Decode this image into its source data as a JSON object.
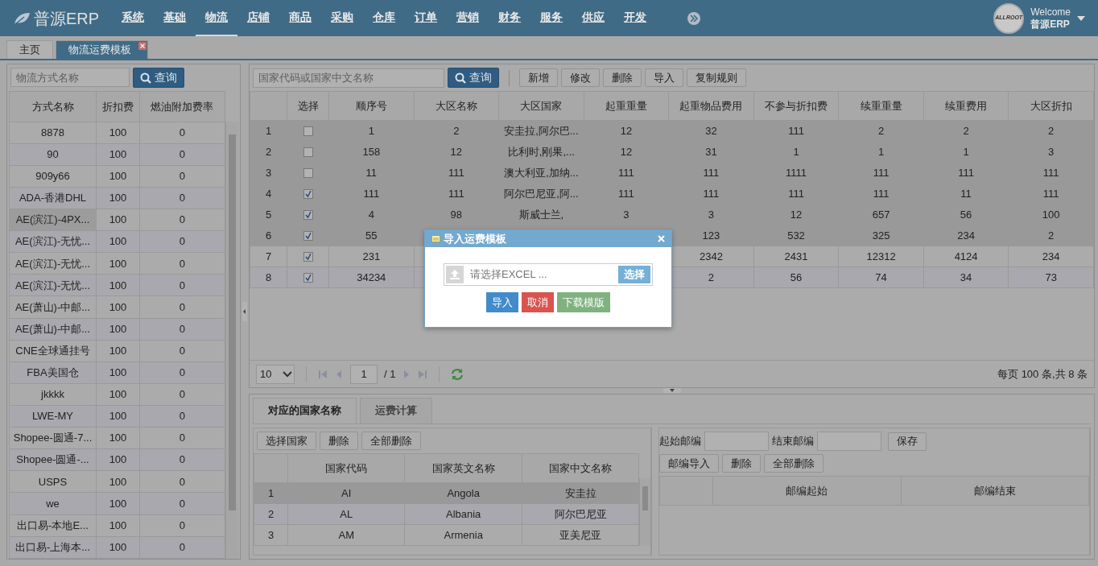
{
  "header": {
    "logo": "普源ERP",
    "nav": [
      {
        "label": "系统",
        "selected": false
      },
      {
        "label": "基础",
        "selected": false
      },
      {
        "label": "物流",
        "selected": true
      },
      {
        "label": "店铺",
        "selected": false
      },
      {
        "label": "商品",
        "selected": false
      },
      {
        "label": "采购",
        "selected": false
      },
      {
        "label": "仓库",
        "selected": false
      },
      {
        "label": "订单",
        "selected": false
      },
      {
        "label": "营销",
        "selected": false
      },
      {
        "label": "财务",
        "selected": false
      },
      {
        "label": "服务",
        "selected": false
      },
      {
        "label": "供应",
        "selected": false
      },
      {
        "label": "开发",
        "selected": false
      }
    ],
    "user": {
      "avatar_text": "ALLROOT",
      "greeting": "Welcome",
      "name": "普源ERP"
    }
  },
  "tabs": [
    {
      "label": "主页",
      "selected": false,
      "closable": false
    },
    {
      "label": "物流运费模板",
      "selected": true,
      "closable": true
    }
  ],
  "left_panel": {
    "search": {
      "placeholder": "物流方式名称"
    },
    "search_button": "查询",
    "columns": [
      "方式名称",
      "折扣费",
      "燃油附加费率"
    ],
    "rows": [
      {
        "cells": [
          "8878",
          "100",
          "0"
        ],
        "selected": false
      },
      {
        "cells": [
          "90",
          "100",
          "0"
        ],
        "selected": false
      },
      {
        "cells": [
          "909y66",
          "100",
          "0"
        ],
        "selected": false
      },
      {
        "cells": [
          "ADA-香港DHL",
          "100",
          "0"
        ],
        "selected": false
      },
      {
        "cells": [
          "AE(滨江)-4PX...",
          "100",
          "0"
        ],
        "selected": true
      },
      {
        "cells": [
          "AE(滨江)-无忧...",
          "100",
          "0"
        ],
        "selected": false
      },
      {
        "cells": [
          "AE(滨江)-无忧...",
          "100",
          "0"
        ],
        "selected": false
      },
      {
        "cells": [
          "AE(滨江)-无忧...",
          "100",
          "0"
        ],
        "selected": false
      },
      {
        "cells": [
          "AE(萧山)-中邮...",
          "100",
          "0"
        ],
        "selected": false
      },
      {
        "cells": [
          "AE(萧山)-中邮...",
          "100",
          "0"
        ],
        "selected": false
      },
      {
        "cells": [
          "CNE全球通挂号",
          "100",
          "0"
        ],
        "selected": false
      },
      {
        "cells": [
          "FBA美国仓",
          "100",
          "0"
        ],
        "selected": false
      },
      {
        "cells": [
          "jkkkk",
          "100",
          "0"
        ],
        "selected": false
      },
      {
        "cells": [
          "LWE-MY",
          "100",
          "0"
        ],
        "selected": false
      },
      {
        "cells": [
          "Shopee-圆通-7...",
          "100",
          "0"
        ],
        "selected": false
      },
      {
        "cells": [
          "Shopee-圆通-...",
          "100",
          "0"
        ],
        "selected": false
      },
      {
        "cells": [
          "USPS",
          "100",
          "0"
        ],
        "selected": false
      },
      {
        "cells": [
          "we",
          "100",
          "0"
        ],
        "selected": false
      },
      {
        "cells": [
          "出口易-本地E...",
          "100",
          "0"
        ],
        "selected": false
      },
      {
        "cells": [
          "出口易-上海本...",
          "100",
          "0"
        ],
        "selected": false
      }
    ]
  },
  "main": {
    "search": {
      "placeholder": "国家代码或国家中文名称"
    },
    "search_button": "查询",
    "toolbar": [
      "新增",
      "修改",
      "删除",
      "导入",
      "复制规则"
    ],
    "select_column": "选择",
    "columns": [
      "顺序号",
      "大区名称",
      "大区国家",
      "起重重量",
      "起重物品费用",
      "不参与折扣费",
      "续重重量",
      "续重费用",
      "大区折扣"
    ],
    "rows": [
      {
        "num": "1",
        "checked": false,
        "selected": true,
        "cells": [
          "1",
          "2",
          "安圭拉,阿尔巴...",
          "12",
          "32",
          "111",
          "2",
          "2",
          "2"
        ]
      },
      {
        "num": "2",
        "checked": false,
        "selected": true,
        "cells": [
          "158",
          "12",
          "比利时,刚果,...",
          "12",
          "31",
          "1",
          "1",
          "1",
          "3"
        ]
      },
      {
        "num": "3",
        "checked": false,
        "selected": true,
        "cells": [
          "11",
          "111",
          "澳大利亚,加纳...",
          "111",
          "111",
          "1111",
          "111",
          "111",
          "111"
        ]
      },
      {
        "num": "4",
        "checked": true,
        "selected": true,
        "cells": [
          "111",
          "111",
          "阿尔巴尼亚,阿...",
          "111",
          "111",
          "111",
          "111",
          "11",
          "111"
        ]
      },
      {
        "num": "5",
        "checked": true,
        "selected": true,
        "cells": [
          "4",
          "98",
          "斯威士兰,",
          "3",
          "3",
          "12",
          "657",
          "56",
          "100"
        ]
      },
      {
        "num": "6",
        "checked": true,
        "selected": true,
        "cells": [
          "55",
          null,
          null,
          null,
          "123",
          "532",
          "325",
          "234",
          "2"
        ]
      },
      {
        "num": "7",
        "checked": true,
        "selected": false,
        "cells": [
          "231",
          null,
          null,
          null,
          "2342",
          "2431",
          "12312",
          "4124",
          "234"
        ]
      },
      {
        "num": "8",
        "checked": true,
        "selected": false,
        "cells": [
          "34234",
          null,
          null,
          null,
          "2",
          "56",
          "74",
          "34",
          "73"
        ]
      }
    ],
    "pagination": {
      "page_size": "10",
      "page": "1",
      "total_pages": "/ 1",
      "summary": "每页 100 条,共 8 条"
    }
  },
  "bottom": {
    "tabs": [
      {
        "label": "对应的国家名称",
        "selected": true
      },
      {
        "label": "运费计算",
        "selected": false
      }
    ],
    "countries": {
      "toolbar": [
        "选择国家",
        "删除",
        "全部删除"
      ],
      "columns": [
        "国家代码",
        "国家英文名称",
        "国家中文名称"
      ],
      "rows": [
        {
          "num": "1",
          "cells": [
            "AI",
            "Angola",
            "安圭拉"
          ],
          "selected": true
        },
        {
          "num": "2",
          "cells": [
            "AL",
            "Albania",
            "阿尔巴尼亚"
          ],
          "selected": false
        },
        {
          "num": "3",
          "cells": [
            "AM",
            "Armenia",
            "亚美尼亚"
          ],
          "selected": false
        }
      ]
    },
    "postcodes": {
      "start_label": "起始邮编",
      "end_label": "结束邮编",
      "save_button": "保存",
      "toolbar": [
        "邮编导入",
        "删除",
        "全部删除"
      ],
      "columns": [
        "邮编起始",
        "邮编结束"
      ]
    }
  },
  "dialog": {
    "title": "导入运费模板",
    "file_placeholder": "请选择EXCEL ...",
    "browse_button": "选择",
    "buttons": [
      {
        "label": "导入",
        "kind": "primary"
      },
      {
        "label": "取消",
        "kind": "danger"
      },
      {
        "label": "下载模版",
        "kind": "success"
      }
    ]
  }
}
